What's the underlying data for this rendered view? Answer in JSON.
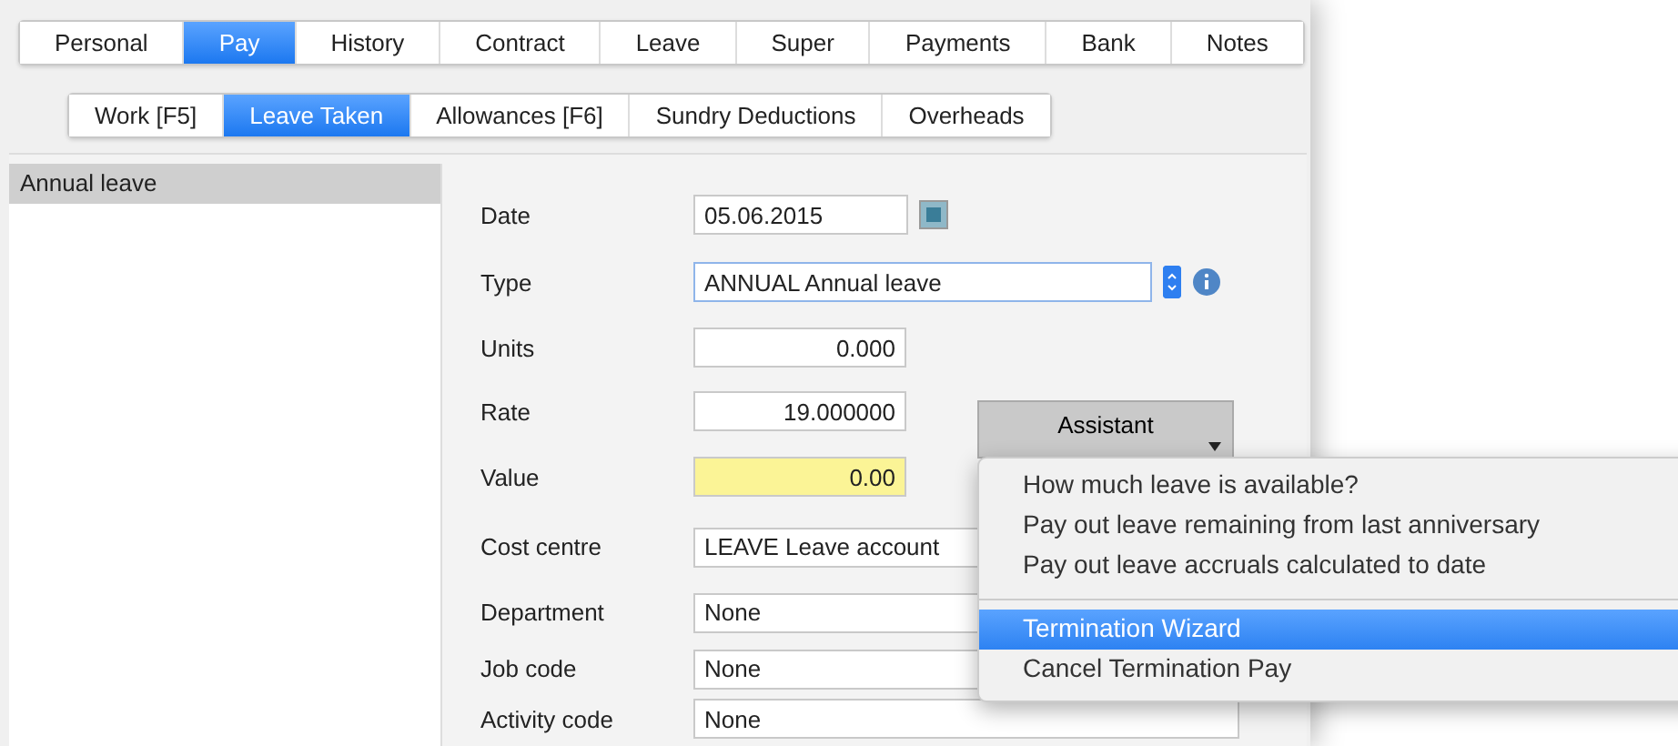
{
  "tabs": [
    {
      "label": "Personal",
      "selected": false
    },
    {
      "label": "Pay",
      "selected": true
    },
    {
      "label": "History",
      "selected": false
    },
    {
      "label": "Contract",
      "selected": false
    },
    {
      "label": "Leave",
      "selected": false
    },
    {
      "label": "Super",
      "selected": false
    },
    {
      "label": "Payments",
      "selected": false
    },
    {
      "label": "Bank",
      "selected": false
    },
    {
      "label": "Notes",
      "selected": false
    }
  ],
  "subtabs": [
    {
      "label": "Work [F5]",
      "selected": false
    },
    {
      "label": "Leave Taken",
      "selected": true
    },
    {
      "label": "Allowances [F6]",
      "selected": false
    },
    {
      "label": "Sundry Deductions",
      "selected": false
    },
    {
      "label": "Overheads",
      "selected": false
    }
  ],
  "leave_list": [
    {
      "label": "Annual leave",
      "selected": true
    }
  ],
  "form": [
    {
      "label": "Date",
      "kind": "date",
      "value": "05.06.2015",
      "highlighted": false
    },
    {
      "label": "Type",
      "kind": "select",
      "value": "ANNUAL Annual leave",
      "highlighted": false
    },
    {
      "label": "Units",
      "kind": "number",
      "value": "0.000",
      "highlighted": false
    },
    {
      "label": "Rate",
      "kind": "number",
      "value": "19.000000",
      "highlighted": false
    },
    {
      "label": "Value",
      "kind": "number",
      "value": "0.00",
      "highlighted": true
    },
    {
      "label": "Cost centre",
      "kind": "lookup",
      "value": "LEAVE Leave account",
      "highlighted": false
    },
    {
      "label": "Department",
      "kind": "lookup",
      "value": "None",
      "highlighted": false
    },
    {
      "label": "Job code",
      "kind": "lookup",
      "value": "None",
      "highlighted": false
    },
    {
      "label": "Activity code",
      "kind": "lookup",
      "value": "None",
      "highlighted": false
    }
  ],
  "assistant": {
    "label": "Assistant",
    "expanded": true
  },
  "assistant_menu": [
    {
      "kind": "item",
      "label": "How much leave is available?",
      "selected": false
    },
    {
      "kind": "item",
      "label": "Pay out leave remaining from last anniversary",
      "selected": false
    },
    {
      "kind": "item",
      "label": "Pay out leave accruals calculated to date",
      "selected": false
    },
    {
      "kind": "separator"
    },
    {
      "kind": "item",
      "label": "Termination Wizard",
      "selected": true
    },
    {
      "kind": "item",
      "label": "Cancel Termination Pay",
      "selected": false
    }
  ]
}
